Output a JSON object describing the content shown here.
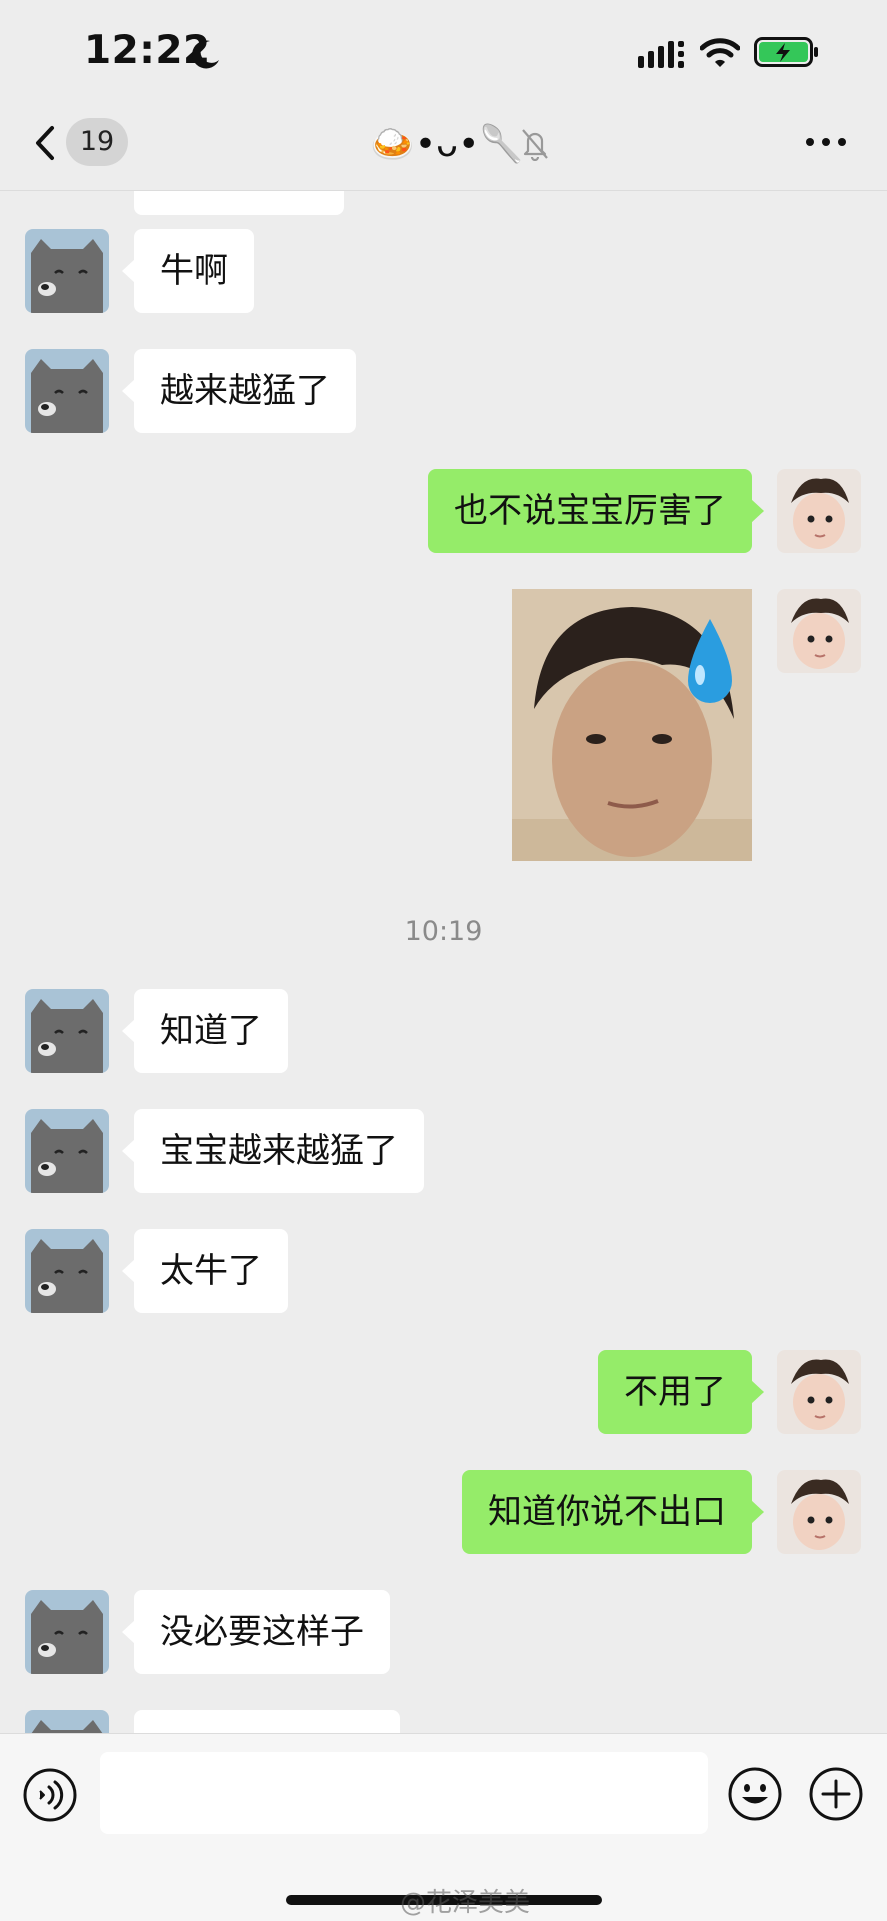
{
  "status_bar": {
    "time": "12:22"
  },
  "nav": {
    "unread_count": "19",
    "chat_title": "🍛•ᴗ•🥄"
  },
  "messages": [
    {
      "side": "in",
      "text": "牛啊"
    },
    {
      "side": "in",
      "text": "越来越猛了"
    },
    {
      "side": "out",
      "text": "也不说宝宝厉害了"
    },
    {
      "side": "out",
      "type": "sticker"
    },
    {
      "type": "time",
      "text": "10:19"
    },
    {
      "side": "in",
      "text": "知道了"
    },
    {
      "side": "in",
      "text": "宝宝越来越猛了"
    },
    {
      "side": "in",
      "text": "太牛了"
    },
    {
      "side": "out",
      "text": "不用了"
    },
    {
      "side": "out",
      "text": "知道你说不出口"
    },
    {
      "side": "in",
      "text": "没必要这样子"
    }
  ],
  "watermark": "@花泽美美",
  "colors": {
    "outgoing_bubble": "#95ec69",
    "incoming_bubble": "#ffffff",
    "background": "#ededed"
  }
}
